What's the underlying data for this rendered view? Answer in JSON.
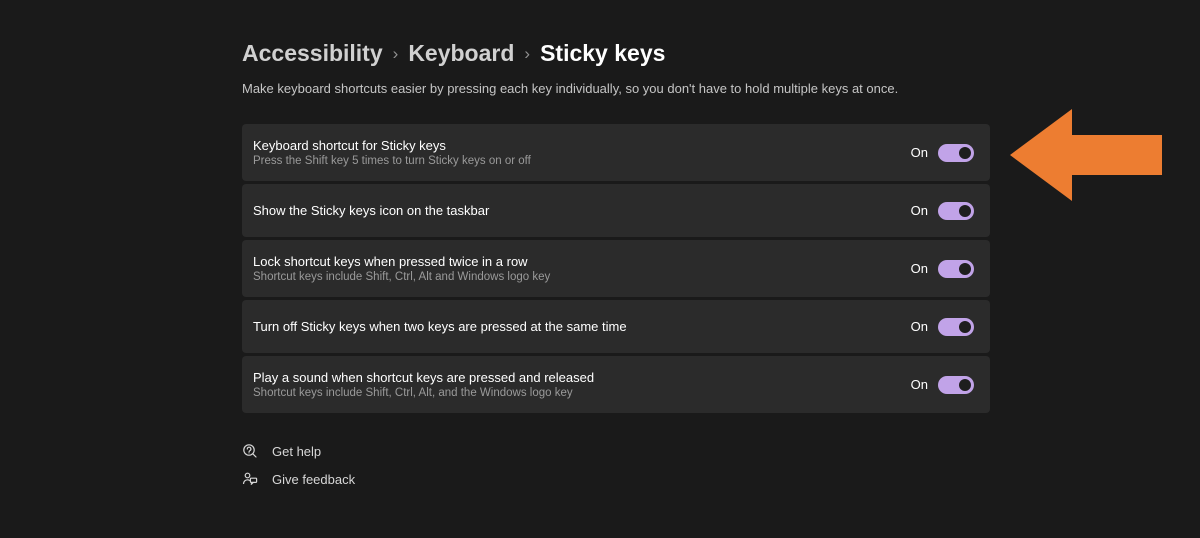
{
  "breadcrumb": {
    "level1": "Accessibility",
    "level2": "Keyboard",
    "current": "Sticky keys"
  },
  "subtitle": "Make keyboard shortcuts easier by pressing each key individually, so you don't have to hold multiple keys at once.",
  "settings": [
    {
      "title": "Keyboard shortcut for Sticky keys",
      "desc": "Press the Shift key 5 times to turn Sticky keys on or off",
      "state": "On"
    },
    {
      "title": "Show the Sticky keys icon on the taskbar",
      "desc": "",
      "state": "On"
    },
    {
      "title": "Lock shortcut keys when pressed twice in a row",
      "desc": "Shortcut keys include Shift, Ctrl, Alt and Windows logo key",
      "state": "On"
    },
    {
      "title": "Turn off Sticky keys when two keys are pressed at the same time",
      "desc": "",
      "state": "On"
    },
    {
      "title": "Play a sound when shortcut keys are pressed and released",
      "desc": "Shortcut keys include Shift, Ctrl, Alt, and the Windows logo key",
      "state": "On"
    }
  ],
  "links": {
    "help": "Get help",
    "feedback": "Give feedback"
  }
}
